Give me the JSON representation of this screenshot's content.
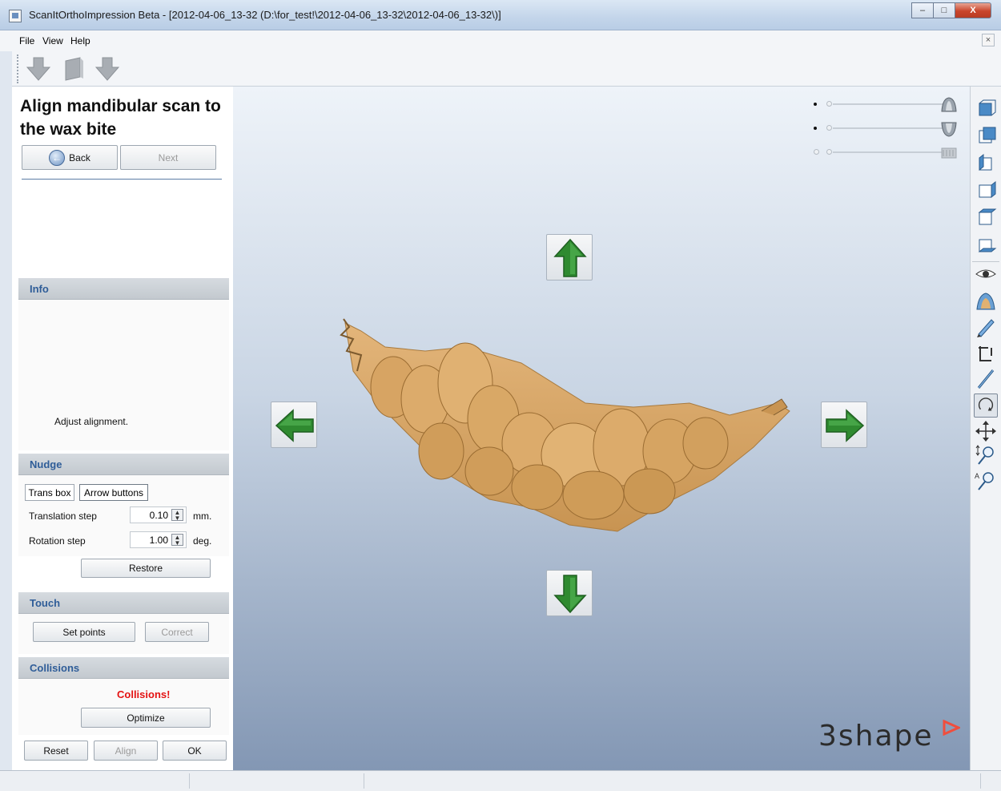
{
  "window": {
    "title": "ScanItOrthoImpression Beta - [2012-04-06_13-32 (D:\\for_test!\\2012-04-06_13-32\\2012-04-06_13-32\\)]",
    "minimize": "–",
    "maximize": "□",
    "close": "X"
  },
  "menu": {
    "file": "File",
    "view": "View",
    "help": "Help",
    "close_x": "×"
  },
  "toolbar": {
    "icons": [
      "arrow-down-icon",
      "scan-cube-icon",
      "arrow-down-icon"
    ]
  },
  "wizard": {
    "title": "Align mandibular scan to the wax bite",
    "back": "Back",
    "next": "Next"
  },
  "info": {
    "header": "Info",
    "text": "Adjust alignment."
  },
  "nudge": {
    "header": "Nudge",
    "tabs": [
      "Trans box",
      "Arrow buttons"
    ],
    "translation_label": "Translation step",
    "translation_value": "0.10",
    "translation_unit": "mm.",
    "rotation_label": "Rotation step",
    "rotation_value": "1.00",
    "rotation_unit": "deg.",
    "restore": "Restore"
  },
  "touch": {
    "header": "Touch",
    "set_points": "Set points",
    "correct": "Correct"
  },
  "collisions": {
    "header": "Collisions",
    "status": "Collisions!",
    "optimize": "Optimize"
  },
  "footer": {
    "reset": "Reset",
    "align": "Align",
    "ok": "OK"
  },
  "viewport": {
    "brand": "3shape",
    "accent_color": "#f04e3e",
    "model_color": "#d9a96a",
    "arrow_color": "#2e8a2e",
    "sliders": [
      {
        "name": "upper-jaw",
        "level": 1.0
      },
      {
        "name": "lower-jaw",
        "level": 1.0
      },
      {
        "name": "wax-bite",
        "level": 1.0
      }
    ]
  },
  "right_tools": [
    "view-front-icon",
    "view-back-icon",
    "view-left-icon",
    "view-right-icon",
    "view-top-icon",
    "view-bottom-icon",
    "eye-icon",
    "visibility-icon",
    "pencil-icon",
    "crop-icon",
    "measure-icon",
    "rotate-icon",
    "pan-icon",
    "zoom-icon",
    "auto-zoom-icon"
  ]
}
